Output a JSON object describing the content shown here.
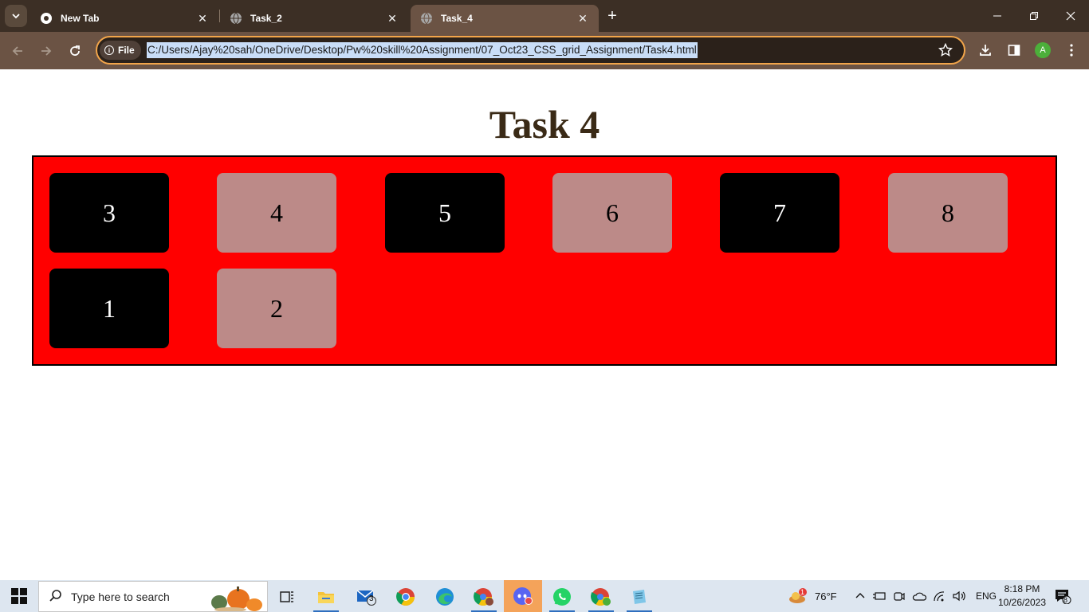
{
  "browser": {
    "tabs": [
      {
        "label": "New Tab",
        "active": false
      },
      {
        "label": "Task_2",
        "active": false
      },
      {
        "label": "Task_4",
        "active": true
      }
    ],
    "address_chip": "File",
    "url": "C:/Users/Ajay%20sah/OneDrive/Desktop/Pw%20skill%20Assignment/07_Oct23_CSS_grid_Assignment/Task4.html",
    "profile_initial": "A"
  },
  "page": {
    "title": "Task 4",
    "grid_items": [
      "3",
      "4",
      "5",
      "6",
      "7",
      "8",
      "1",
      "2"
    ]
  },
  "taskbar": {
    "search_placeholder": "Type here to search",
    "mail_badge": "3",
    "weather_badge": "1",
    "temperature": "76°F",
    "language": "ENG",
    "time": "8:18 PM",
    "date": "10/26/2023",
    "notification_count": "8"
  },
  "colors": {
    "grid_background": "#ff0000",
    "dark_cell": "#000000",
    "light_cell": "#bc8a88",
    "title_color": "#3a2a16",
    "tab_bar": "#3c2f25",
    "toolbar": "#6b5344",
    "omnibox_focus": "#f2a54a"
  }
}
